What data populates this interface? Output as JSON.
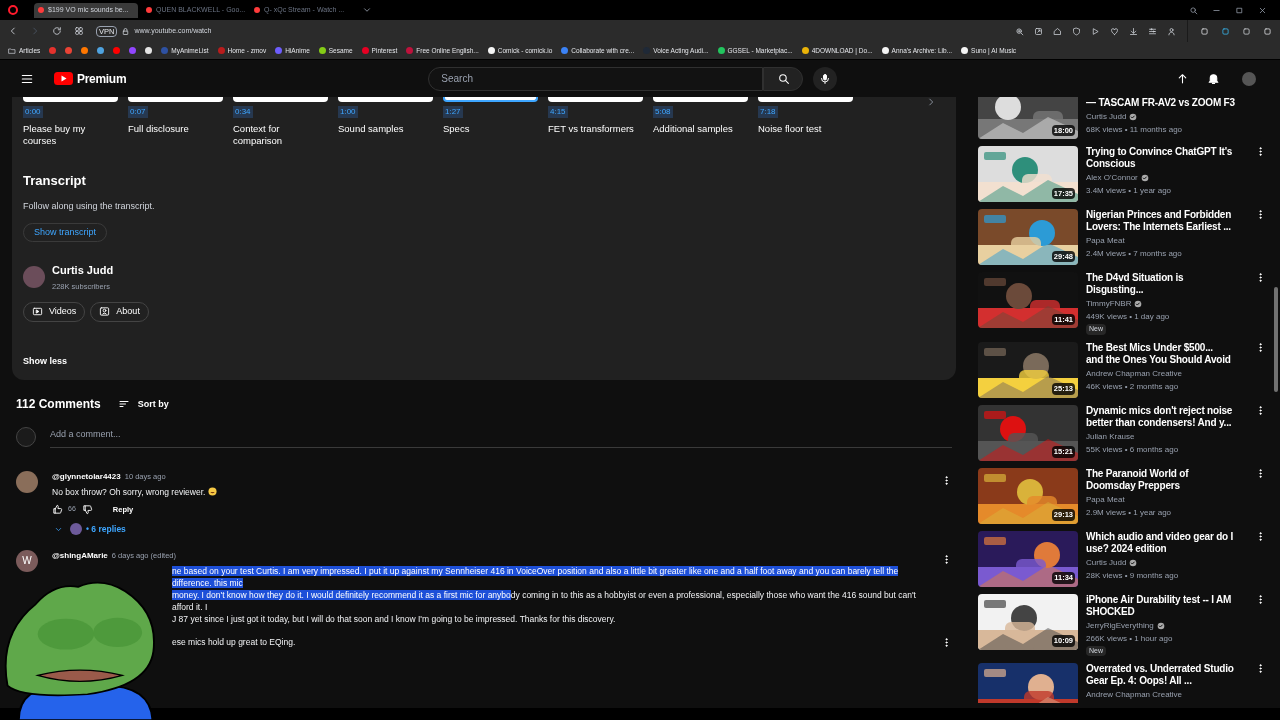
{
  "browser": {
    "tabs": [
      {
        "title": "$199 VO mic sounds be...",
        "selected": true
      },
      {
        "title": "QUEN BLACKWELL - Goo...",
        "selected": false
      },
      {
        "title": "Q- xQc Stream - Watch ...",
        "selected": false
      }
    ],
    "vpn_badge": "VPN",
    "url": "www.youtube.com/watch",
    "bookmarks": [
      {
        "kind": "link",
        "label": "Articles"
      },
      {
        "kind": "icon",
        "color": "#e5322d"
      },
      {
        "kind": "icon",
        "color": "#ea4335"
      },
      {
        "kind": "icon",
        "color": "#ff7700"
      },
      {
        "kind": "icon",
        "color": "#4fa3e0"
      },
      {
        "kind": "icon",
        "color": "#ff0000"
      },
      {
        "kind": "icon",
        "color": "#9146ff"
      },
      {
        "kind": "icon",
        "color": "#e5e5e5"
      },
      {
        "kind": "link",
        "label": "MyAnimeList",
        "color": "#2e51a2"
      },
      {
        "kind": "link",
        "label": "Home - zmov",
        "color": "#b91c1c"
      },
      {
        "kind": "link",
        "label": "HiAnime",
        "color": "#6d5dfc"
      },
      {
        "kind": "link",
        "label": "Sesame",
        "color": "#84cc16"
      },
      {
        "kind": "link",
        "label": "Pinterest",
        "color": "#e60023"
      },
      {
        "kind": "link",
        "label": "Free Online English...",
        "color": "#be123c"
      },
      {
        "kind": "link",
        "label": "Comick - comick.io",
        "color": "#f5f5f5"
      },
      {
        "kind": "link",
        "label": "Collaborate with cre...",
        "color": "#3b82f6"
      },
      {
        "kind": "link",
        "label": "Voice Acting Audi...",
        "color": "#1f2937"
      },
      {
        "kind": "link",
        "label": "GGSEL - Marketplac...",
        "color": "#22c55e"
      },
      {
        "kind": "link",
        "label": "4DOWNLOAD | Do...",
        "color": "#eab308"
      },
      {
        "kind": "link",
        "label": "Anna's Archive: Lib...",
        "color": "#f5f5f5"
      },
      {
        "kind": "link",
        "label": "Suno | AI Music",
        "color": "#f5f5f5"
      }
    ]
  },
  "header": {
    "logo_text": "Premium",
    "search": {
      "placeholder": "Search"
    }
  },
  "chapters": [
    {
      "time": "0:00",
      "title": "Please buy my courses",
      "selected": false
    },
    {
      "time": "0:07",
      "title": "Full disclosure",
      "selected": false
    },
    {
      "time": "0:34",
      "title": "Context for comparison",
      "selected": false
    },
    {
      "time": "1:00",
      "title": "Sound samples",
      "selected": false
    },
    {
      "time": "1:27",
      "title": "Specs",
      "selected": true
    },
    {
      "time": "4:15",
      "title": "FET vs transformers",
      "selected": false
    },
    {
      "time": "5:08",
      "title": "Additional samples",
      "selected": false
    },
    {
      "time": "7:18",
      "title": "Noise floor test",
      "selected": false
    }
  ],
  "transcript": {
    "heading": "Transcript",
    "text": "Follow along using the transcript.",
    "button": "Show transcript"
  },
  "channel": {
    "name": "Curtis Judd",
    "subscribers": "228K subscribers",
    "buttons": [
      {
        "kind": "videos",
        "label": "Videos"
      },
      {
        "kind": "about",
        "label": "About"
      }
    ]
  },
  "show_less": "Show less",
  "comments": {
    "count": "112 Comments",
    "sort": "Sort by",
    "add_placeholder": "Add a comment...",
    "items": [
      {
        "author": "@glynnetolar4423",
        "time": "10 days ago",
        "lines": [
          {
            "plain": "No box throw? Oh sorry, wrong reviewer."
          }
        ],
        "emoji": true,
        "likes": "66",
        "reply": "Reply",
        "replies": "• 6 replies"
      },
      {
        "author": "@shingAMarie",
        "time": "6 days ago (edited)",
        "avatar_letter": "W",
        "lines": [
          {
            "highlighted": "ne based on your test Curtis. I am very impressed. I put it up against my Sennheiser 416 in VoiceOver position and also a little bit greater like one and a half foot away and you can barely tell the difference. this mic"
          },
          {
            "highlighted": "money. I don't know how they do it. I would definitely recommend it as a first mic for anybo",
            "plain": "dy coming in to this as a hobbyist or even a professional, especially those who want the 416 sound but can't afford it. I"
          },
          {
            "plain": "J 87 yet since I just got it today, but I will do that soon and I know I'm going to be impressed. Thanks for this discovery."
          }
        ]
      },
      {
        "lines": [
          {
            "plain": "ese mics hold up great to EQing."
          }
        ]
      }
    ]
  },
  "related": [
    {
      "kind": "cut_top",
      "title_lines": [
        "— TASCAM FR-AV2 vs ZOOM F3"
      ],
      "channel": "Curtis Judd",
      "verified": true,
      "meta": "68K views • 11 months ago",
      "duration": "18:00",
      "new": false
    },
    {
      "kind": "full",
      "title_lines": [
        "Trying to Convince ChatGPT It's",
        "Conscious"
      ],
      "channel": "Alex O'Connor",
      "verified": true,
      "meta": "3.4M views • 1 year ago",
      "duration": "17:35",
      "new": false
    },
    {
      "kind": "full",
      "title_lines": [
        "Nigerian Princes and Forbidden",
        "Lovers: The Internets Earliest ..."
      ],
      "channel": "Papa Meat",
      "verified": false,
      "meta": "2.4M views • 7 months ago",
      "duration": "29:48",
      "new": false
    },
    {
      "kind": "full",
      "title_lines": [
        "The D4vd Situation is",
        "Disgusting..."
      ],
      "channel": "TimmyFNBR",
      "verified": true,
      "meta": "449K views • 1 day ago",
      "duration": "11:41",
      "new": true,
      "new_label": "New"
    },
    {
      "kind": "full",
      "title_lines": [
        "The Best Mics Under $500...",
        "and the Ones You Should Avoid"
      ],
      "channel": "Andrew Chapman Creative",
      "verified": false,
      "meta": "46K views • 2 months ago",
      "duration": "25:13",
      "new": false
    },
    {
      "kind": "full",
      "title_lines": [
        "Dynamic mics don't reject noise",
        "better than condensers! And y..."
      ],
      "channel": "Julian Krause",
      "verified": false,
      "meta": "55K views • 6 months ago",
      "duration": "15:21",
      "new": false
    },
    {
      "kind": "full",
      "title_lines": [
        "The Paranoid World of",
        "Doomsday Preppers"
      ],
      "channel": "Papa Meat",
      "verified": false,
      "meta": "2.9M views • 1 year ago",
      "duration": "29:13",
      "new": false
    },
    {
      "kind": "full",
      "title_lines": [
        "Which audio and video gear do I",
        "use? 2024 edition"
      ],
      "channel": "Curtis Judd",
      "verified": true,
      "meta": "28K views • 9 months ago",
      "duration": "11:34",
      "new": false
    },
    {
      "kind": "full",
      "title_lines": [
        "iPhone Air Durability test -- I AM",
        "SHOCKED"
      ],
      "channel": "JerryRigEverything",
      "verified": true,
      "meta": "266K views • 1 hour ago",
      "duration": "10:09",
      "new": true,
      "new_label": "New"
    },
    {
      "kind": "cut_bottom",
      "title_lines": [
        "Overrated vs. Underrated Studio",
        "Gear Ep. 4: Oops! All ..."
      ],
      "channel": "Andrew Chapman Creative",
      "verified": false,
      "new": false
    }
  ]
}
